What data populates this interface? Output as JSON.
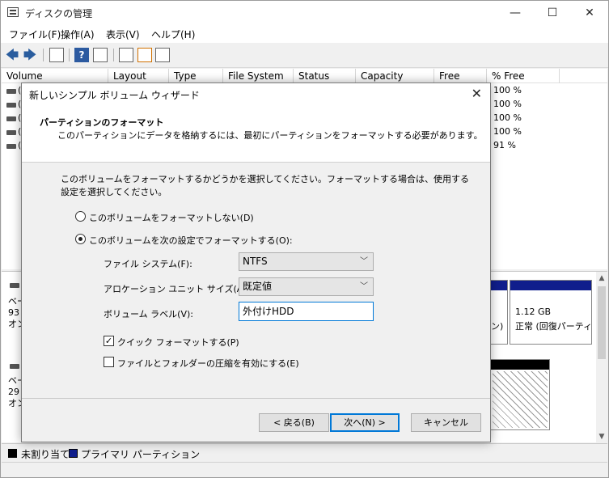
{
  "window": {
    "title": "ディスクの管理",
    "controls": {
      "minimize": "—",
      "maximize": "☐",
      "close": "✕"
    }
  },
  "menu": [
    {
      "label": "ファイル(F)"
    },
    {
      "label": "操作(A)"
    },
    {
      "label": "表示(V)"
    },
    {
      "label": "ヘルプ(H)"
    }
  ],
  "toolbar": {
    "back": "🡄",
    "forward": "🡆",
    "help": "?"
  },
  "volume_list": {
    "columns": [
      "Volume",
      "Layout",
      "Type",
      "File System",
      "Status",
      "Capacity",
      "Free Spa...",
      "% Free"
    ],
    "rows": [
      {
        "initial": "(",
        "pct_free": "100 %"
      },
      {
        "initial": "(",
        "pct_free": "100 %"
      },
      {
        "initial": "(",
        "pct_free": "100 %"
      },
      {
        "initial": "(",
        "pct_free": "100 %"
      },
      {
        "initial": "(",
        "pct_free": "91 %"
      }
    ]
  },
  "disk_map": {
    "disk1": {
      "line1": "ベー",
      "line2": "93",
      "line3": "オン"
    },
    "disk2": {
      "line1": "ベー",
      "line2": "29",
      "line3": "オン"
    },
    "partition_right": {
      "size": "1.12 GB",
      "status": "正常 (回復パーティ"
    },
    "partition_mid_fragment": "ン)"
  },
  "legend": {
    "unallocated": "未割り当て",
    "primary": "プライマリ パーティション",
    "colors": {
      "unallocated": "#000000",
      "primary": "#101e8c"
    }
  },
  "dialog": {
    "title": "新しいシンプル ボリューム ウィザード",
    "close": "✕",
    "header_title": "パーティションのフォーマット",
    "header_subtitle": "このパーティションにデータを格納するには、最初にパーティションをフォーマットする必要があります。",
    "intro": "このボリュームをフォーマットするかどうかを選択してください。フォーマットする場合は、使用する設定を選択してください。",
    "option_no_format": "このボリュームをフォーマットしない(D)",
    "option_format": "このボリュームを次の設定でフォーマットする(O):",
    "fs_label": "ファイル システム(F):",
    "fs_value": "NTFS",
    "alloc_label": "アロケーション ユニット サイズ(A):",
    "alloc_value": "既定値",
    "vol_label_label": "ボリューム ラベル(V):",
    "vol_label_value": "外付けHDD",
    "quick_format": "クイック フォーマットする(P)",
    "quick_format_checked": true,
    "compression": "ファイルとフォルダーの圧縮を有効にする(E)",
    "compression_checked": false,
    "btn_back": "< 戻る(B)",
    "btn_next": "次へ(N) >",
    "btn_cancel": "キャンセル",
    "accent": "#0078d7"
  }
}
